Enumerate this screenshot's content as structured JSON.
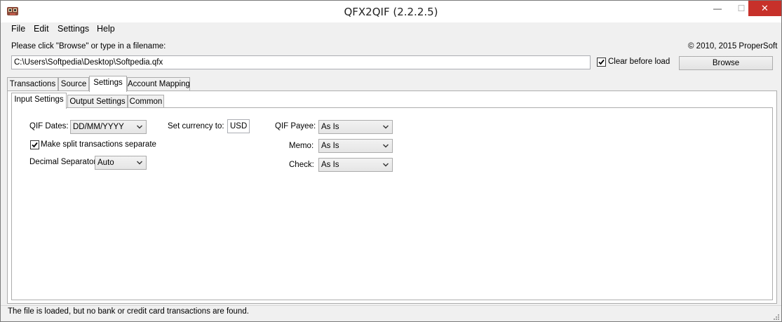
{
  "window": {
    "title": "QFX2QIF (2.2.2.5)",
    "min_glyph": "—",
    "max_glyph": "☐",
    "close_glyph": "✕",
    "app_icon": "qfx2qif-app-icon"
  },
  "menu": [
    "File",
    "Edit",
    "Settings",
    "Help"
  ],
  "file_select": {
    "prompt": "Please click \"Browse\" or type in a filename:",
    "copyright": "© 2010, 2015 ProperSoft",
    "path_value": "C:\\Users\\Softpedia\\Desktop\\Softpedia.qfx",
    "clear_before_load_label": "Clear before load",
    "clear_before_load_checked": true,
    "browse_label": "Browse"
  },
  "main_tabs": [
    "Transactions",
    "Source",
    "Settings",
    "Account Mapping"
  ],
  "main_tabs_active": "Settings",
  "sub_tabs": [
    "Input Settings",
    "Output Settings",
    "Common"
  ],
  "sub_tabs_active": "Input Settings",
  "input_settings": {
    "qif_dates_label": "QIF Dates:",
    "qif_dates_value": "DD/MM/YYYY",
    "split_label": "Make split transactions separate",
    "split_checked": true,
    "decimal_label": "Decimal Separator:",
    "decimal_value": "Auto",
    "currency_label": "Set currency to:",
    "currency_value": "USD",
    "payee_label": "QIF Payee:",
    "payee_value": "As Is",
    "memo_label": "Memo:",
    "memo_value": "As Is",
    "check_label": "Check:",
    "check_value": "As Is"
  },
  "status": {
    "text": "The file is loaded, but no bank or credit card transactions are found."
  },
  "colors": {
    "close_button": "#c7312a",
    "window_bg": "#f0f0f0",
    "border": "#adadad"
  }
}
